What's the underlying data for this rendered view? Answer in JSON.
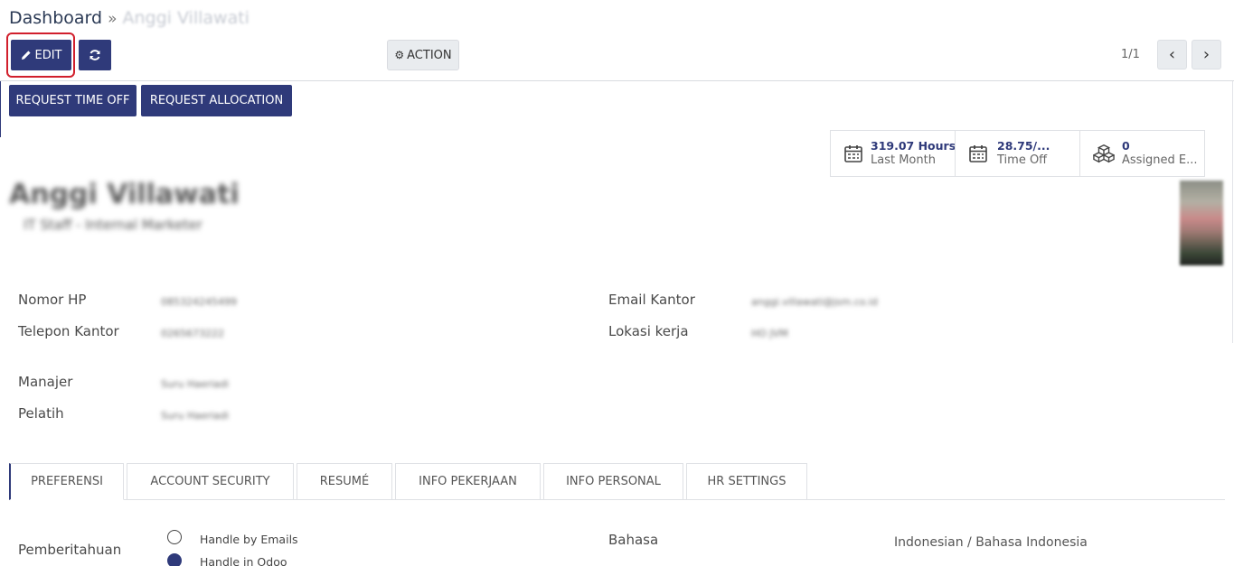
{
  "breadcrumb": {
    "root": "Dashboard",
    "separator": "»",
    "current": "Anggi Villawati"
  },
  "toolbar": {
    "edit_label": "EDIT",
    "action_label": "ACTION",
    "pager": "1/1"
  },
  "header_buttons": {
    "request_time_off": "REQUEST TIME OFF",
    "request_allocation": "REQUEST ALLOCATION"
  },
  "stats": [
    {
      "value": "319.07 Hours",
      "label": "Last Month",
      "icon": "calendar-icon"
    },
    {
      "value": "28.75/...",
      "label": "Time Off",
      "icon": "calendar-icon"
    },
    {
      "value": "0",
      "label": "Assigned E...",
      "icon": "cubes-icon"
    }
  ],
  "employee": {
    "name": "Anggi Villawati",
    "job_title": "IT Staff - Internal Marketer"
  },
  "fields": {
    "nomor_hp": {
      "label": "Nomor HP",
      "value": "085324245499"
    },
    "telepon_kantor": {
      "label": "Telepon Kantor",
      "value": "0265673222"
    },
    "email_kantor": {
      "label": "Email Kantor",
      "value": "anggi.villawati@jsm.co.id"
    },
    "lokasi_kerja": {
      "label": "Lokasi kerja",
      "value": "HO JVM"
    },
    "manajer": {
      "label": "Manajer",
      "value": "Suru Haeriadi"
    },
    "pelatih": {
      "label": "Pelatih",
      "value": "Suru Haeriadi"
    }
  },
  "tabs": [
    "PREFERENSI",
    "ACCOUNT SECURITY",
    "RESUMÉ",
    "INFO PEKERJAAN",
    "INFO PERSONAL",
    "HR SETTINGS"
  ],
  "preferences": {
    "notification_label": "Pemberitahuan",
    "options": [
      "Handle by Emails",
      "Handle in Odoo"
    ],
    "language_label": "Bahasa",
    "language_value": "Indonesian / Bahasa Indonesia"
  },
  "colors": {
    "primary": "#2f3a7a",
    "highlight": "#d11f2c"
  }
}
